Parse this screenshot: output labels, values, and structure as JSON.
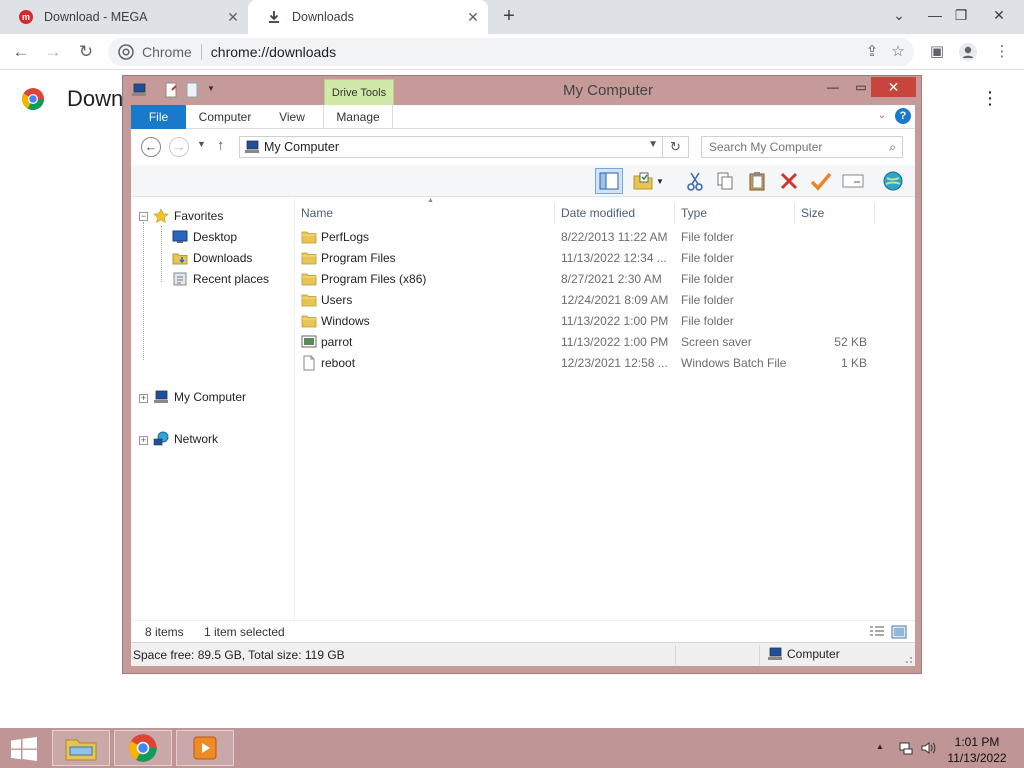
{
  "browser": {
    "tabs": [
      {
        "title": "Download - MEGA",
        "icon": "mega-icon",
        "active": false
      },
      {
        "title": "Downloads",
        "icon": "download-icon",
        "active": true
      }
    ],
    "address_site": "Chrome",
    "address_url": "chrome://downloads",
    "page_heading": "Down"
  },
  "explorer": {
    "title": "My Computer",
    "contextual_tab": "Drive Tools",
    "ribbon_tabs": [
      "File",
      "Computer",
      "View",
      "Manage"
    ],
    "address": "My Computer",
    "search_placeholder": "Search My Computer",
    "nav": {
      "favorites": "Favorites",
      "favorites_items": [
        "Desktop",
        "Downloads",
        "Recent places"
      ],
      "my_computer": "My Computer",
      "network": "Network"
    },
    "columns": {
      "name": "Name",
      "date": "Date modified",
      "type": "Type",
      "size": "Size"
    },
    "files": [
      {
        "name": "PerfLogs",
        "date": "8/22/2013 11:22 AM",
        "type": "File folder",
        "size": "",
        "icon": "folder-icon"
      },
      {
        "name": "Program Files",
        "date": "11/13/2022 12:34 ...",
        "type": "File folder",
        "size": "",
        "icon": "folder-icon"
      },
      {
        "name": "Program Files (x86)",
        "date": "8/27/2021 2:30 AM",
        "type": "File folder",
        "size": "",
        "icon": "folder-icon"
      },
      {
        "name": "Users",
        "date": "12/24/2021 8:09 AM",
        "type": "File folder",
        "size": "",
        "icon": "folder-icon"
      },
      {
        "name": "Windows",
        "date": "11/13/2022 1:00 PM",
        "type": "File folder",
        "size": "",
        "icon": "folder-icon"
      },
      {
        "name": "parrot",
        "date": "11/13/2022 1:00 PM",
        "type": "Screen saver",
        "size": "52 KB",
        "icon": "screensaver-icon"
      },
      {
        "name": "reboot",
        "date": "12/23/2021 12:58 ...",
        "type": "Windows Batch File",
        "size": "1 KB",
        "icon": "file-icon"
      }
    ],
    "status_count": "8 items",
    "status_selected": "1 item selected",
    "space_info": "Space free: 89.5 GB, Total size: 119 GB",
    "zone": "Computer"
  },
  "taskbar": {
    "apps": [
      "file-explorer-icon",
      "chrome-icon",
      "media-player-icon"
    ],
    "time": "1:01 PM",
    "date": "11/13/2022"
  },
  "colors": {
    "window_frame": "#c79a9a",
    "taskbar": "#bf9596",
    "ribbon_file": "#1979ca",
    "drive_tools": "#d0e8a8",
    "folder": "#e8c454"
  }
}
